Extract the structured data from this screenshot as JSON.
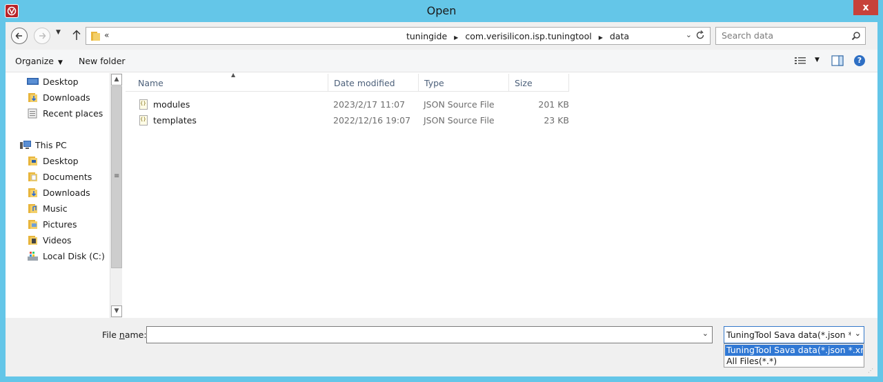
{
  "window": {
    "title": "Open",
    "close_label": "x"
  },
  "address": {
    "overflow": "«",
    "crumbs": [
      "tuningide",
      "com.verisilicon.isp.tuningtool",
      "data"
    ]
  },
  "search": {
    "placeholder": "Search data"
  },
  "toolbar": {
    "organize_label": "Organize",
    "new_folder_label": "New folder",
    "help_label": "?"
  },
  "sidebar": {
    "items": [
      {
        "label": "Desktop",
        "icon": "desktop-icon"
      },
      {
        "label": "Downloads",
        "icon": "downloads-icon"
      },
      {
        "label": "Recent places",
        "icon": "recent-places-icon"
      },
      {
        "label": "This PC",
        "icon": "this-pc-icon"
      },
      {
        "label": "Desktop",
        "icon": "desktop-folder-icon"
      },
      {
        "label": "Documents",
        "icon": "documents-icon"
      },
      {
        "label": "Downloads",
        "icon": "downloads-icon"
      },
      {
        "label": "Music",
        "icon": "music-icon"
      },
      {
        "label": "Pictures",
        "icon": "pictures-icon"
      },
      {
        "label": "Videos",
        "icon": "videos-icon"
      },
      {
        "label": "Local Disk (C:)",
        "icon": "local-disk-icon"
      }
    ]
  },
  "files": {
    "columns": [
      "Name",
      "Date modified",
      "Type",
      "Size"
    ],
    "rows": [
      {
        "name": "modules",
        "date": "2023/2/17 11:07",
        "type": "JSON Source File",
        "size": "201 KB"
      },
      {
        "name": "templates",
        "date": "2022/12/16 19:07",
        "type": "JSON Source File",
        "size": "23 KB"
      }
    ]
  },
  "footer": {
    "file_name_label_pre": "File ",
    "file_name_label_u": "n",
    "file_name_label_post": "ame:",
    "file_name_value": "",
    "file_type_selected": "TuningTool Sava data(*.json *.xml)",
    "file_type_options": [
      "TuningTool Sava data(*.json *.xml)",
      "All Files(*.*)"
    ]
  },
  "colors": {
    "titlebar": "#64c6e8",
    "close": "#c7413a",
    "selection": "#3078d4"
  }
}
